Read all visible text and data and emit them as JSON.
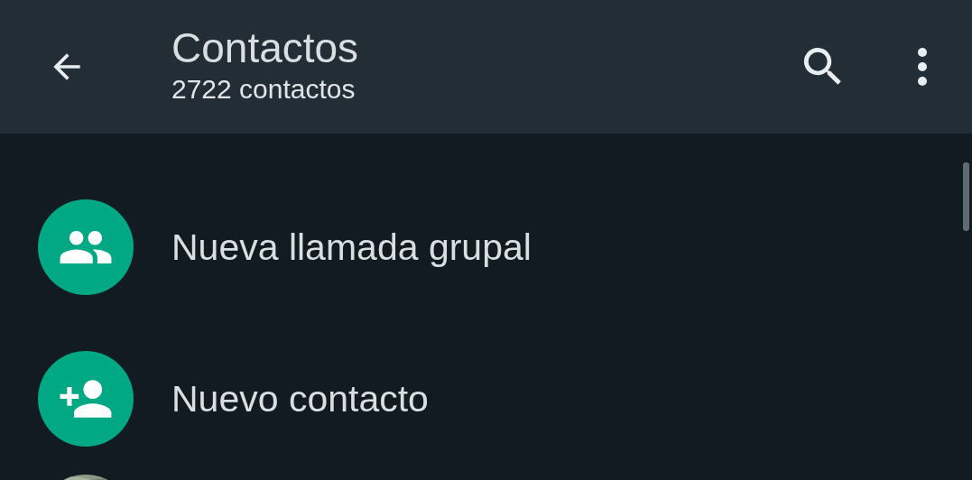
{
  "header": {
    "title": "Contactos",
    "subtitle": "2722 contactos"
  },
  "actions": [
    {
      "label": "Nueva llamada grupal",
      "kind": "group"
    },
    {
      "label": "Nuevo contacto",
      "kind": "add-person"
    }
  ]
}
